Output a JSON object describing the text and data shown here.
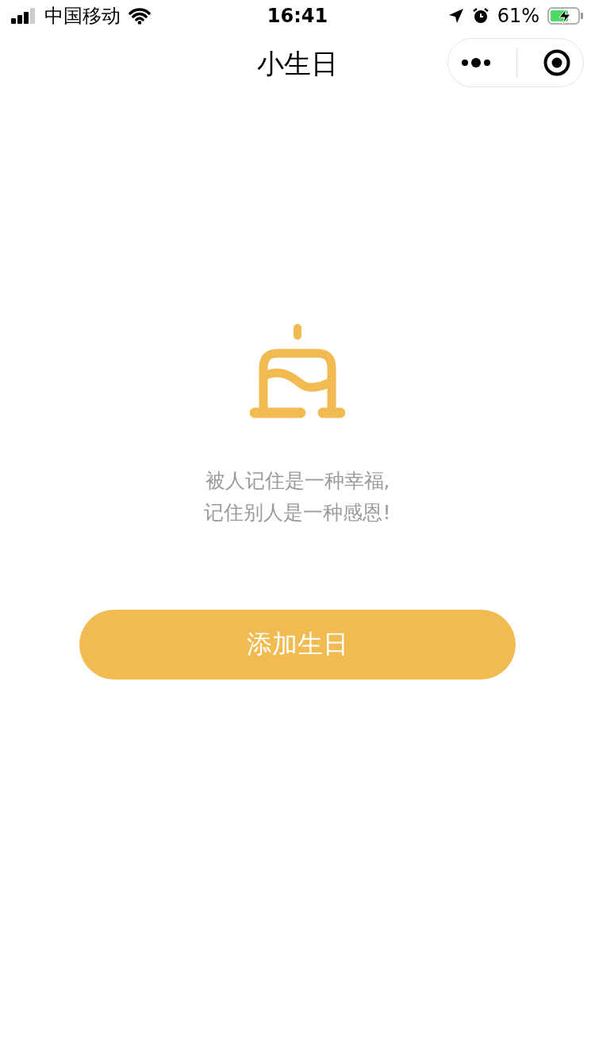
{
  "status_bar": {
    "carrier": "中国移动",
    "time": "16:41",
    "battery": "61%"
  },
  "nav_bar": {
    "title": "小生日"
  },
  "empty_state": {
    "lines": [
      "被人记住是一种幸福,",
      "记住别人是一种感恩!"
    ]
  },
  "add_button": {
    "label": "添加生日"
  }
}
